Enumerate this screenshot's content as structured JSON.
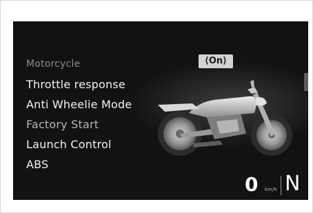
{
  "menu": {
    "items": [
      {
        "label": "Motorcycle"
      },
      {
        "label": "Throttle response"
      },
      {
        "label": "Anti Wheelie Mode"
      },
      {
        "label": "Factory Start"
      },
      {
        "label": "Launch Control"
      },
      {
        "label": "ABS"
      }
    ],
    "selected_value": "⟨On⟩"
  },
  "status": {
    "speed": "0",
    "speed_unit": "km/h",
    "gear": "N"
  },
  "icons": {
    "bike": "motorcycle-icon"
  },
  "colors": {
    "screen_background": "#121212",
    "text_primary": "#f2f2f2",
    "text_dim": "#8c8c8c",
    "badge_background": "#d2d2d2"
  }
}
